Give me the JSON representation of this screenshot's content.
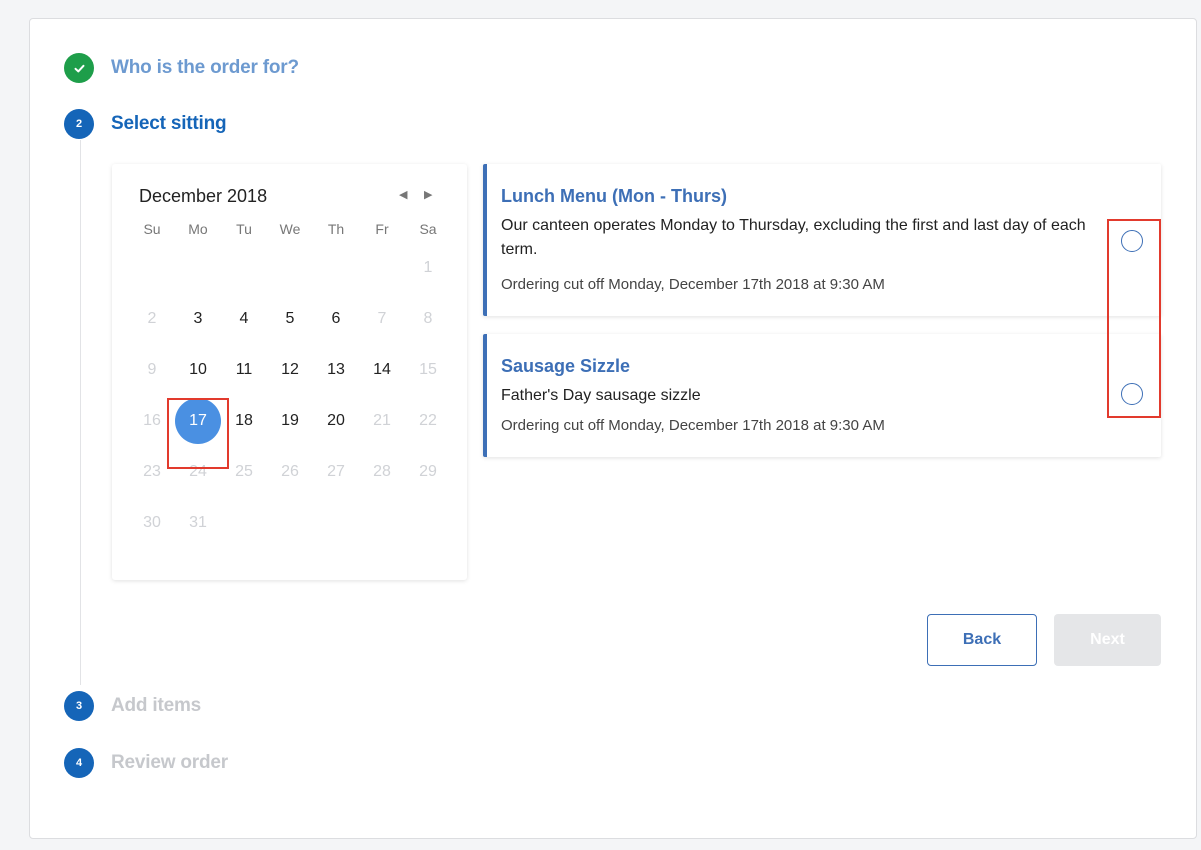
{
  "steps": [
    {
      "number": "✓",
      "title": "Who is the order for?"
    },
    {
      "number": "2",
      "title": "Select sitting"
    },
    {
      "number": "3",
      "title": "Add items"
    },
    {
      "number": "4",
      "title": "Review order"
    }
  ],
  "calendar": {
    "month_label": "December 2018",
    "prev_icon": "◀",
    "next_icon": "▶",
    "weekdays": [
      "Su",
      "Mo",
      "Tu",
      "We",
      "Th",
      "Fr",
      "Sa"
    ],
    "selected_day": "17"
  },
  "sittings": [
    {
      "title": "Lunch Menu (Mon - Thurs)",
      "description": "Our canteen operates Monday to Thursday, excluding the first and last day of each term.",
      "cutoff": "Ordering cut off Monday, December 17th 2018 at 9:30 AM"
    },
    {
      "title": "Sausage Sizzle",
      "description": "Father's Day sausage sizzle",
      "cutoff": "Ordering cut off Monday, December 17th 2018 at 9:30 AM"
    }
  ],
  "buttons": {
    "back": "Back",
    "next": "Next"
  },
  "colors": {
    "step_done": "#1e9e4a",
    "step_active": "#1565b8",
    "step_active_text": "#1565b8",
    "step_done_text": "#6d9ad0",
    "step_inactive_text": "#c6c8cc",
    "accent": "#3d6fb6",
    "selected_day": "#4a90e2",
    "highlight": "#e23a2d"
  },
  "icons": {
    "check": "check-icon",
    "prev": "triangle-left-icon",
    "next": "triangle-right-icon"
  }
}
